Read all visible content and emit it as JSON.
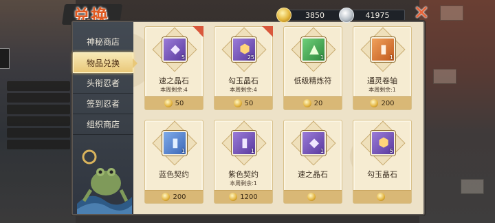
{
  "header": {
    "title": "兑换",
    "gold_amount": "3850",
    "silver_amount": "41975",
    "close_symbol": "✕"
  },
  "sidebar": {
    "tabs": [
      {
        "label": "神秘商店",
        "active": false
      },
      {
        "label": "物品兑换",
        "active": true
      },
      {
        "label": "头衔忍者",
        "active": false
      },
      {
        "label": "签到忍者",
        "active": false
      },
      {
        "label": "组织商店",
        "active": false
      }
    ]
  },
  "items": [
    {
      "name": "速之晶石",
      "limit": "本周剩余:4",
      "price": "50",
      "qty": "5",
      "color": "purple",
      "icon": "crystal-icon",
      "glyph": "◆",
      "glyph_color": "#efe6ff"
    },
    {
      "name": "勾玉晶石",
      "limit": "本周剩余:4",
      "price": "50",
      "qty": "25",
      "color": "purple",
      "icon": "magatama-crystal-icon",
      "glyph": "⬢",
      "glyph_color": "#ffd57a"
    },
    {
      "name": "低级精炼符",
      "limit": "",
      "price": "20",
      "qty": "1",
      "color": "green",
      "icon": "refining-talisman-icon",
      "glyph": "▲",
      "glyph_color": "#eaffd8"
    },
    {
      "name": "通灵卷轴",
      "limit": "本周剩余:1",
      "price": "200",
      "qty": "1",
      "color": "orange",
      "icon": "summoning-scroll-icon",
      "glyph": "▮",
      "glyph_color": "#fff0e0"
    },
    {
      "name": "蓝色契约",
      "limit": "",
      "price": "200",
      "qty": "1",
      "color": "blue",
      "icon": "blue-contract-icon",
      "glyph": "▮",
      "glyph_color": "#e3efff"
    },
    {
      "name": "紫色契约",
      "limit": "本周剩余:1",
      "price": "1200",
      "qty": "1",
      "color": "purple",
      "icon": "purple-contract-icon",
      "glyph": "▮",
      "glyph_color": "#f0e8ff"
    },
    {
      "name": "速之晶石",
      "limit": "",
      "price": "",
      "qty": "1",
      "color": "purple",
      "icon": "crystal-icon",
      "glyph": "◆",
      "glyph_color": "#efe6ff"
    },
    {
      "name": "勾玉晶石",
      "limit": "",
      "price": "",
      "qty": "5",
      "color": "purple",
      "icon": "magatama-crystal-icon",
      "glyph": "⬢",
      "glyph_color": "#ffd57a"
    }
  ]
}
